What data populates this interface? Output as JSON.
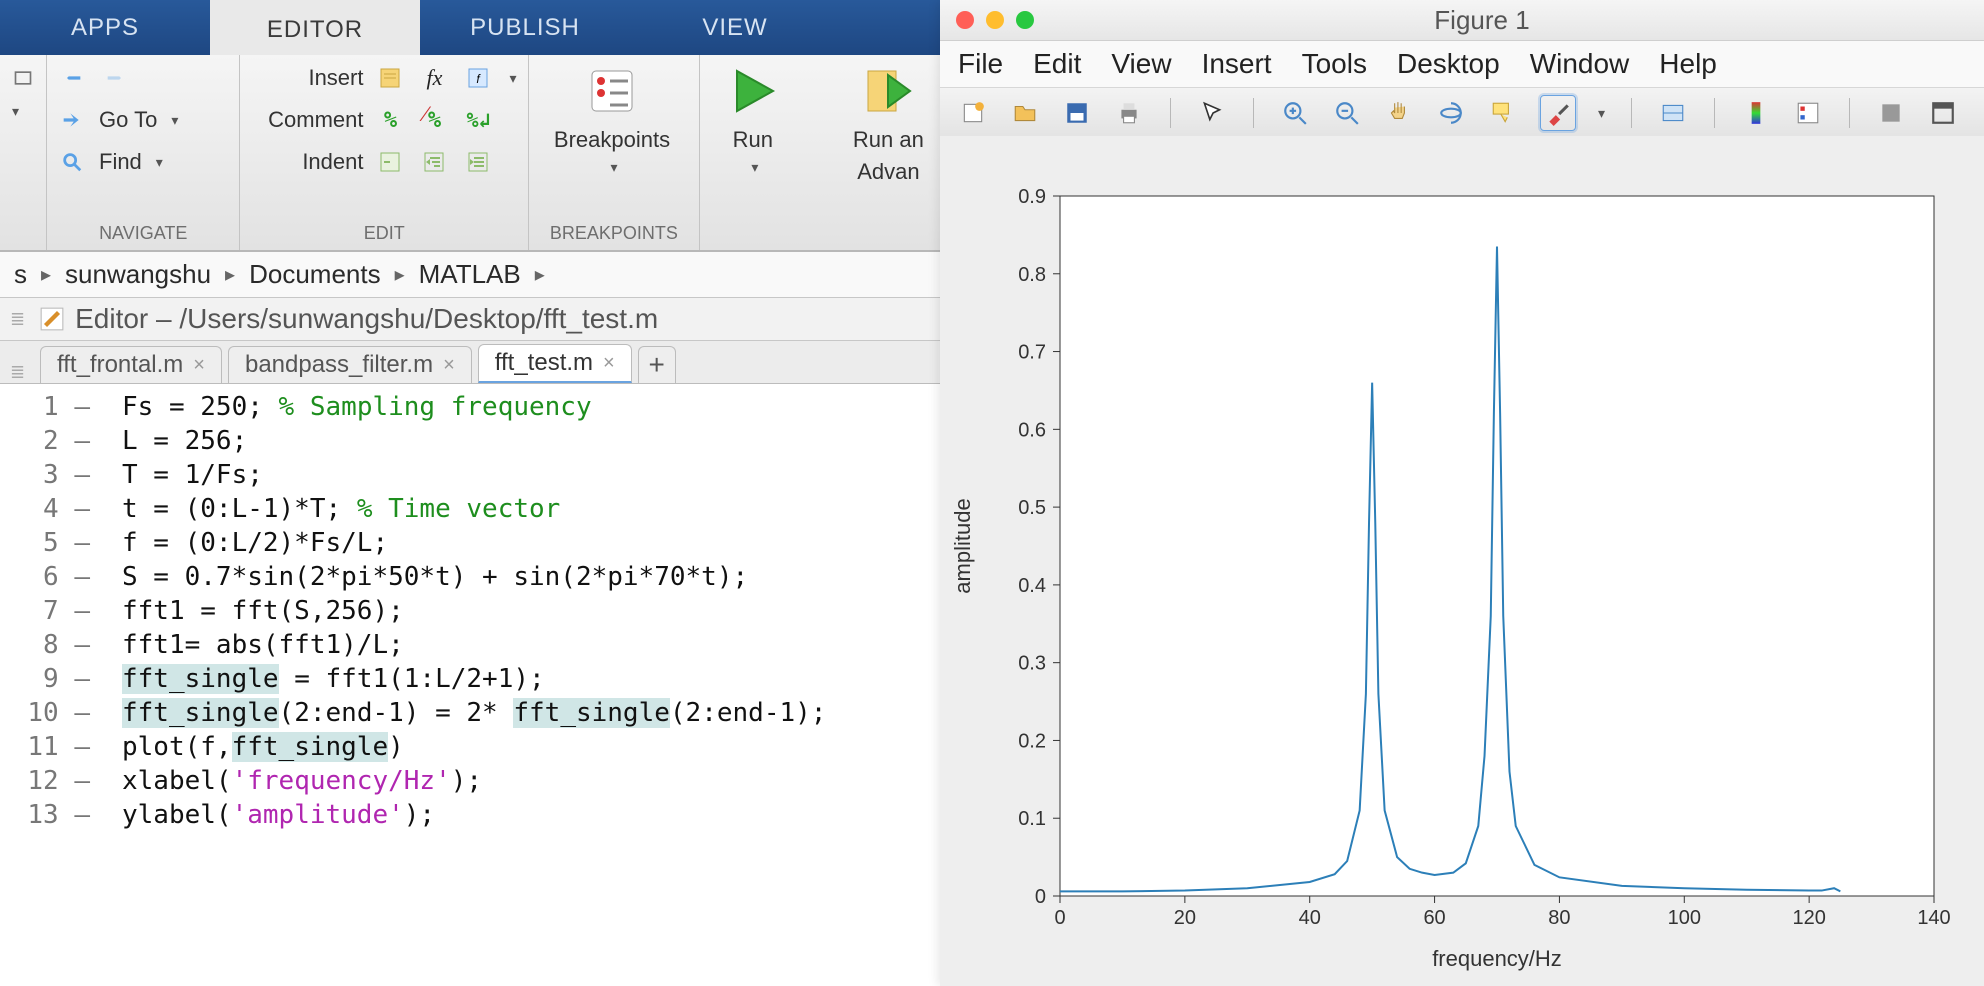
{
  "ribbon": {
    "tabs": [
      "APPS",
      "EDITOR",
      "PUBLISH",
      "VIEW"
    ],
    "active_tab": 1,
    "navigate": {
      "goto": "Go To",
      "find": "Find",
      "label": "NAVIGATE"
    },
    "edit": {
      "insert": "Insert",
      "comment": "Comment",
      "indent": "Indent",
      "label": "EDIT"
    },
    "breakpoints": {
      "btn": "Breakpoints",
      "label": "BREAKPOINTS"
    },
    "run_group": {
      "run": "Run",
      "run_advance_top": "Run an",
      "run_advance_bot": "Advan"
    }
  },
  "breadcrumb": [
    "s",
    "sunwangshu",
    "Documents",
    "MATLAB"
  ],
  "editor_title": "Editor – /Users/sunwangshu/Desktop/fft_test.m",
  "filetabs": [
    {
      "name": "fft_frontal.m",
      "active": false
    },
    {
      "name": "bandpass_filter.m",
      "active": false
    },
    {
      "name": "fft_test.m",
      "active": true
    }
  ],
  "code_lines": [
    [
      {
        "t": "Fs = 250; "
      },
      {
        "t": "% Sampling frequency",
        "cls": "cm"
      }
    ],
    [
      {
        "t": "L = 256;"
      }
    ],
    [
      {
        "t": "T = 1/Fs;"
      }
    ],
    [
      {
        "t": "t = (0:L-1)*T; "
      },
      {
        "t": "% Time vector",
        "cls": "cm"
      }
    ],
    [
      {
        "t": "f = (0:L/2)*Fs/L;"
      }
    ],
    [
      {
        "t": "S = 0.7*sin(2*pi*50*t) + sin(2*pi*70*t);"
      }
    ],
    [
      {
        "t": "fft1 = fft(S,256);"
      }
    ],
    [
      {
        "t": "fft1= abs(fft1)/L;"
      }
    ],
    [
      {
        "t": "fft_single",
        "cls": "hl"
      },
      {
        "t": " = fft1(1:L/2+1);"
      }
    ],
    [
      {
        "t": "fft_single",
        "cls": "hl"
      },
      {
        "t": "(2:end-1) = 2* "
      },
      {
        "t": "fft_single",
        "cls": "hl"
      },
      {
        "t": "(2:end-1);"
      }
    ],
    [
      {
        "t": "plot(f,"
      },
      {
        "t": "fft_single",
        "cls": "hl"
      },
      {
        "t": ")"
      }
    ],
    [
      {
        "t": "xlabel("
      },
      {
        "t": "'frequency/Hz'",
        "cls": "str"
      },
      {
        "t": ");"
      }
    ],
    [
      {
        "t": "ylabel("
      },
      {
        "t": "'amplitude'",
        "cls": "str"
      },
      {
        "t": ");"
      }
    ]
  ],
  "figure": {
    "title": "Figure 1",
    "menus": [
      "File",
      "Edit",
      "View",
      "Insert",
      "Tools",
      "Desktop",
      "Window",
      "Help"
    ],
    "toolbar_icons": [
      "new-figure-icon",
      "open-icon",
      "save-icon",
      "print-icon",
      "sep",
      "pointer-icon",
      "sep",
      "zoom-in-icon",
      "zoom-out-icon",
      "pan-icon",
      "rotate3d-icon",
      "datatip-icon",
      "brush-icon",
      "dd",
      "sep",
      "link-icon",
      "sep",
      "colorbar-icon",
      "legend-icon",
      "sep",
      "hide-tools-icon",
      "dock-icon"
    ]
  },
  "chart_data": {
    "type": "line",
    "title": "",
    "xlabel": "frequency/Hz",
    "ylabel": "amplitude",
    "xlim": [
      0,
      140
    ],
    "ylim": [
      0,
      0.9
    ],
    "xticks": [
      0,
      20,
      40,
      60,
      80,
      100,
      120,
      140
    ],
    "yticks": [
      0,
      0.1,
      0.2,
      0.3,
      0.4,
      0.5,
      0.6,
      0.7,
      0.8,
      0.9
    ],
    "series": [
      {
        "name": "fft_single",
        "color": "#2c7fb8",
        "x": [
          0,
          10,
          20,
          30,
          40,
          44,
          46,
          48,
          49,
          49.5,
          50,
          50.5,
          51,
          52,
          54,
          56,
          58,
          60,
          63,
          65,
          67,
          68,
          69,
          69.5,
          70,
          70.5,
          71,
          72,
          73,
          76,
          80,
          90,
          100,
          110,
          120,
          122,
          124,
          125
        ],
        "y": [
          0.006,
          0.006,
          0.007,
          0.01,
          0.018,
          0.028,
          0.045,
          0.11,
          0.26,
          0.48,
          0.66,
          0.48,
          0.26,
          0.11,
          0.05,
          0.035,
          0.03,
          0.027,
          0.03,
          0.042,
          0.09,
          0.18,
          0.36,
          0.62,
          0.835,
          0.62,
          0.36,
          0.16,
          0.09,
          0.04,
          0.024,
          0.013,
          0.01,
          0.008,
          0.007,
          0.007,
          0.01,
          0.006
        ]
      }
    ]
  }
}
